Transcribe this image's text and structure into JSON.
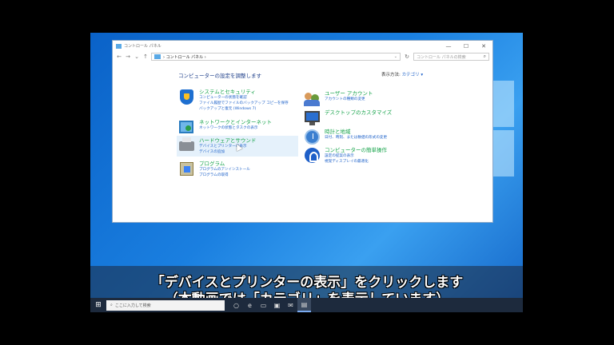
{
  "window": {
    "title": "コントロール パネル",
    "controls": [
      "—",
      "☐",
      "✕"
    ],
    "address": "コントロール パネル",
    "search_placeholder": "コントロール パネルの検索"
  },
  "content": {
    "heading": "コンピューターの設定を調整します",
    "view_by_label": "表示方法:",
    "view_by_value": "カテゴリ ▾"
  },
  "categories_left": [
    {
      "title": "システムとセキュリティ",
      "links": [
        "コンピューターの状態を確認",
        "ファイル履歴でファイルのバックアップ コピーを保存",
        "バックアップと復元 (Windows 7)"
      ]
    },
    {
      "title": "ネットワークとインターネット",
      "links": [
        "ネットワークの状態とタスクの表示"
      ]
    },
    {
      "title": "ハードウェアとサウンド",
      "links": [
        "デバイスとプリンターの表示",
        "デバイスの追加"
      ]
    },
    {
      "title": "プログラム",
      "links": [
        "プログラムのアンインストール",
        "プログラムの取得"
      ]
    }
  ],
  "categories_right": [
    {
      "title": "ユーザー アカウント",
      "links": [
        "アカウントの種類の変更"
      ]
    },
    {
      "title": "デスクトップのカスタマイズ",
      "links": []
    },
    {
      "title": "時計と地域",
      "links": [
        "日付、時刻、または数値の形式の変更"
      ]
    },
    {
      "title": "コンピューターの簡単操作",
      "links": [
        "設定の提案の表示",
        "視覚ディスプレイの最適化"
      ]
    }
  ],
  "subtitle": {
    "line1": "「デバイスとプリンターの表示」をクリックします",
    "line2": "（本動画では「カテゴリ」を表示しています）"
  },
  "taskbar": {
    "start": "⊞",
    "search": "ここに入力して検索",
    "icons": [
      "task-view-icon",
      "edge-icon",
      "explorer-icon",
      "store-icon",
      "mail-icon",
      "control-panel-icon"
    ]
  },
  "colors": {
    "link": "#1a5fc8",
    "category_title": "#16a34a",
    "heading": "#1e3f8a",
    "desktop": "#1a7fe0"
  }
}
